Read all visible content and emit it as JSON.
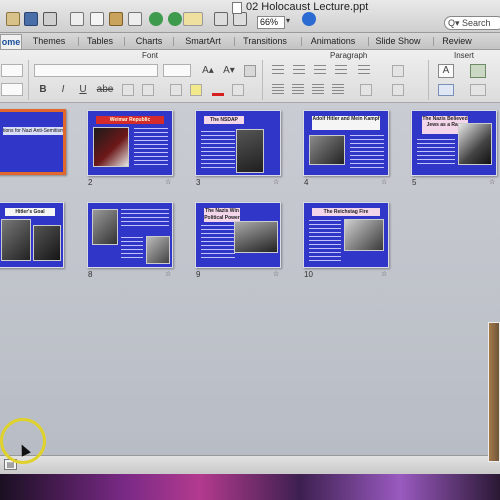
{
  "window": {
    "title": "02 Holocaust Lecture.ppt"
  },
  "toolbar": {
    "zoom": "66%",
    "zoom_arrow": "▾",
    "search_placeholder": "Q▾ Search"
  },
  "tabs": [
    {
      "label": "ome",
      "active": true
    },
    {
      "label": "Themes"
    },
    {
      "label": "Tables"
    },
    {
      "label": "Charts"
    },
    {
      "label": "SmartArt"
    },
    {
      "label": "Transitions"
    },
    {
      "label": "Animations"
    },
    {
      "label": "Slide Show"
    },
    {
      "label": "Review"
    }
  ],
  "ribbon": {
    "groups": {
      "font": "Font",
      "paragraph": "Paragraph",
      "insert": "Insert"
    },
    "format_buttons": [
      "B",
      "I",
      "U",
      "abe"
    ],
    "size_buttons": [
      "A▴",
      "A▾"
    ],
    "insert_button": "A"
  },
  "slides": [
    {
      "number": "",
      "title": "tions for Nazi Anti-Semitism",
      "selected": true
    },
    {
      "number": "2",
      "title": "Weimar Republic"
    },
    {
      "number": "3",
      "title": "The NSDAP"
    },
    {
      "number": "4",
      "title": "Adolf Hitler and Mein Kampf"
    },
    {
      "number": "5",
      "title": "The Nazis Believed Jews as a Race"
    },
    {
      "number": "",
      "title": "Hitler's Goal"
    },
    {
      "number": "8",
      "title": ""
    },
    {
      "number": "9",
      "title": "The Nazis Win Political Power"
    },
    {
      "number": "10",
      "title": "The Reichstag Fire"
    }
  ],
  "slide_star": "☆",
  "status": {
    "view_icon": "▤"
  }
}
